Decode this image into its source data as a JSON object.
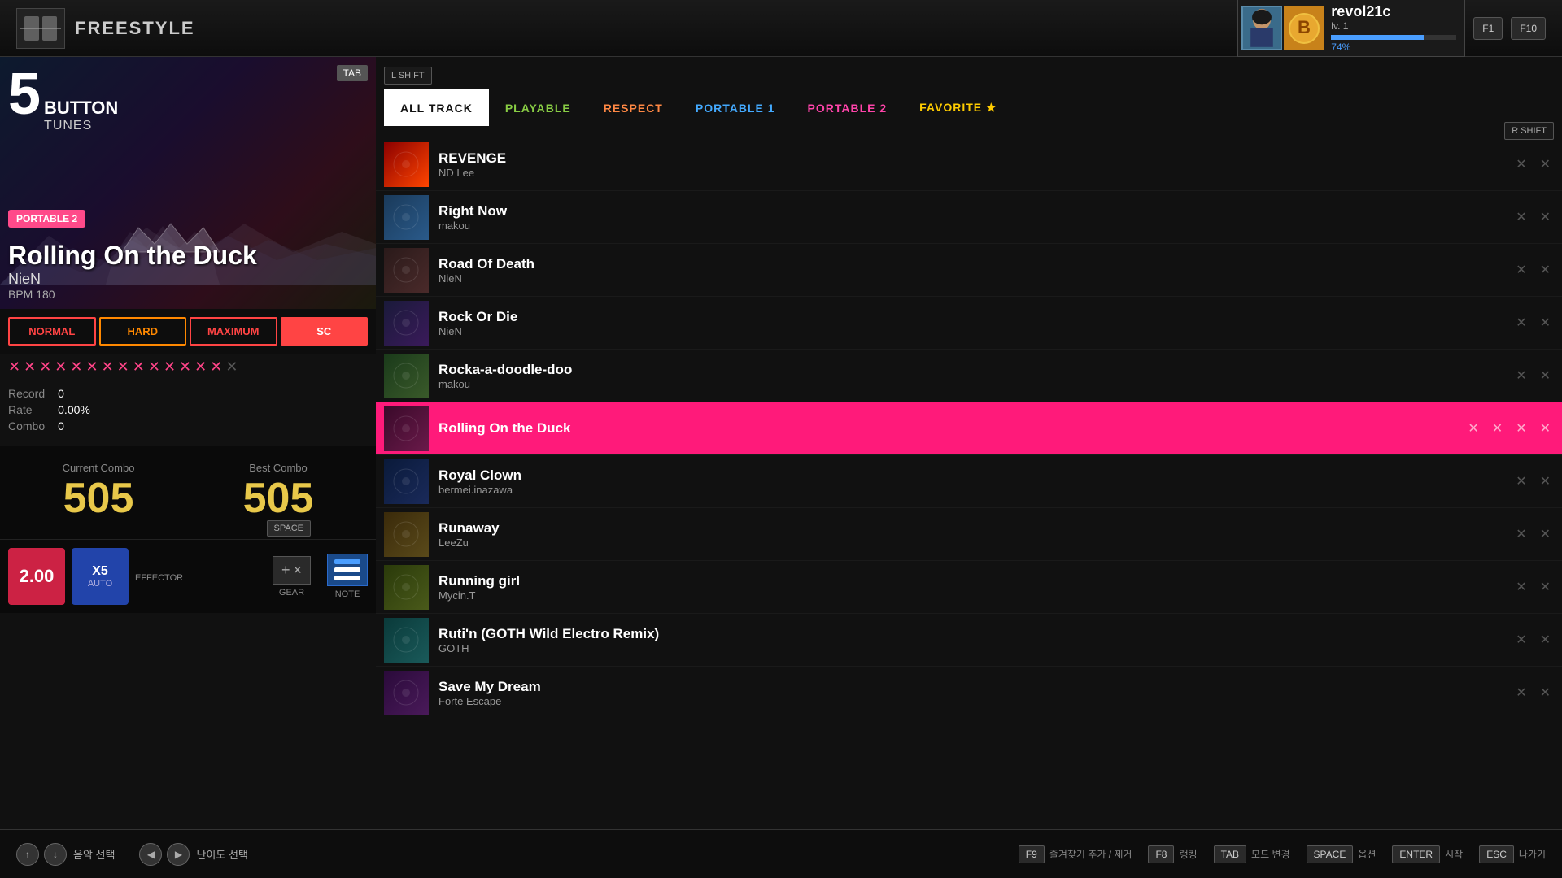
{
  "app": {
    "mode": "FREESTYLE",
    "lshift_key": "L SHIFT",
    "rshift_key": "R SHIFT",
    "space_key": "SPACE"
  },
  "user": {
    "name": "revol21c",
    "level": "lv. 1",
    "xp_percent": 74,
    "xp_label": "74%"
  },
  "song": {
    "button_count": "5",
    "button_label": "BUTTON",
    "tunes_label": "TUNES",
    "tab_label": "TAB",
    "badge_label": "PORTABLE 2",
    "title": "Rolling On the Duck",
    "artist": "NieN",
    "bpm_label": "BPM",
    "bpm_value": "180",
    "difficulties": [
      "NORMAL",
      "HARD",
      "MAXIMUM",
      "SC"
    ],
    "active_diff": "SC",
    "rating_count": 15,
    "record_label": "Record",
    "record_value": "0",
    "rate_label": "Rate",
    "rate_value": "0.00%",
    "combo_label": "Combo",
    "combo_value": "0",
    "current_combo_label": "Current Combo",
    "current_combo_value": "505",
    "best_combo_label": "Best Combo",
    "best_combo_value": "505"
  },
  "controls": {
    "speed_value": "2.00",
    "fever_label": "X5",
    "fever_sub": "AUTO",
    "effector_label": "EFFECTOR",
    "gear_label": "GEAR",
    "note_label": "NOTE",
    "plus_sign": "+",
    "x_sign": "×"
  },
  "bottom_bar": {
    "music_select_key": "↑↓",
    "music_select_label": "음악 선택",
    "difficulty_key": "◀▶",
    "difficulty_label": "난이도 선택",
    "f9_label": "F9",
    "f9_action": "즐겨찾기 추가 / 제거",
    "f8_label": "F8",
    "f8_action": "랭킹",
    "tab_label": "TAB",
    "tab_action": "모드 변경",
    "space_label": "SPACE",
    "space_action": "옵션",
    "enter_label": "ENTER",
    "enter_action": "시작",
    "esc_label": "ESC",
    "esc_action": "나가기"
  },
  "filter_tabs": [
    {
      "id": "all-track",
      "label": "ALL TRACK",
      "active": true
    },
    {
      "id": "playable",
      "label": "PLAYABLE",
      "active": false
    },
    {
      "id": "respect",
      "label": "RESPECT",
      "active": false
    },
    {
      "id": "portable1",
      "label": "PORTABLE 1",
      "active": false
    },
    {
      "id": "portable2",
      "label": "PORTABLE 2",
      "active": false
    },
    {
      "id": "favorite",
      "label": "FAVORITE ★",
      "active": false
    }
  ],
  "tracks": [
    {
      "id": 1,
      "title": "REVENGE",
      "artist": "ND Lee",
      "selected": false,
      "thumb_class": "thumb-revenge"
    },
    {
      "id": 2,
      "title": "Right Now",
      "artist": "makou",
      "selected": false,
      "thumb_class": "thumb-rightnow"
    },
    {
      "id": 3,
      "title": "Road Of Death",
      "artist": "NieN",
      "selected": false,
      "thumb_class": "thumb-road"
    },
    {
      "id": 4,
      "title": "Rock Or Die",
      "artist": "NieN",
      "selected": false,
      "thumb_class": "thumb-rock"
    },
    {
      "id": 5,
      "title": "Rocka-a-doodle-doo",
      "artist": "makou",
      "selected": false,
      "thumb_class": "thumb-rocka"
    },
    {
      "id": 6,
      "title": "Rolling On the Duck",
      "artist": "",
      "selected": true,
      "thumb_class": "thumb-rolling"
    },
    {
      "id": 7,
      "title": "Royal Clown",
      "artist": "bermei.inazawa",
      "selected": false,
      "thumb_class": "thumb-royal"
    },
    {
      "id": 8,
      "title": "Runaway",
      "artist": "LeeZu",
      "selected": false,
      "thumb_class": "thumb-runaway"
    },
    {
      "id": 9,
      "title": "Running girl",
      "artist": "Mycin.T",
      "selected": false,
      "thumb_class": "thumb-running"
    },
    {
      "id": 10,
      "title": "Ruti'n (GOTH Wild Electro Remix)",
      "artist": "GOTH",
      "selected": false,
      "thumb_class": "thumb-rutin"
    },
    {
      "id": 11,
      "title": "Save My Dream",
      "artist": "Forte Escape",
      "selected": false,
      "thumb_class": "thumb-save"
    }
  ]
}
